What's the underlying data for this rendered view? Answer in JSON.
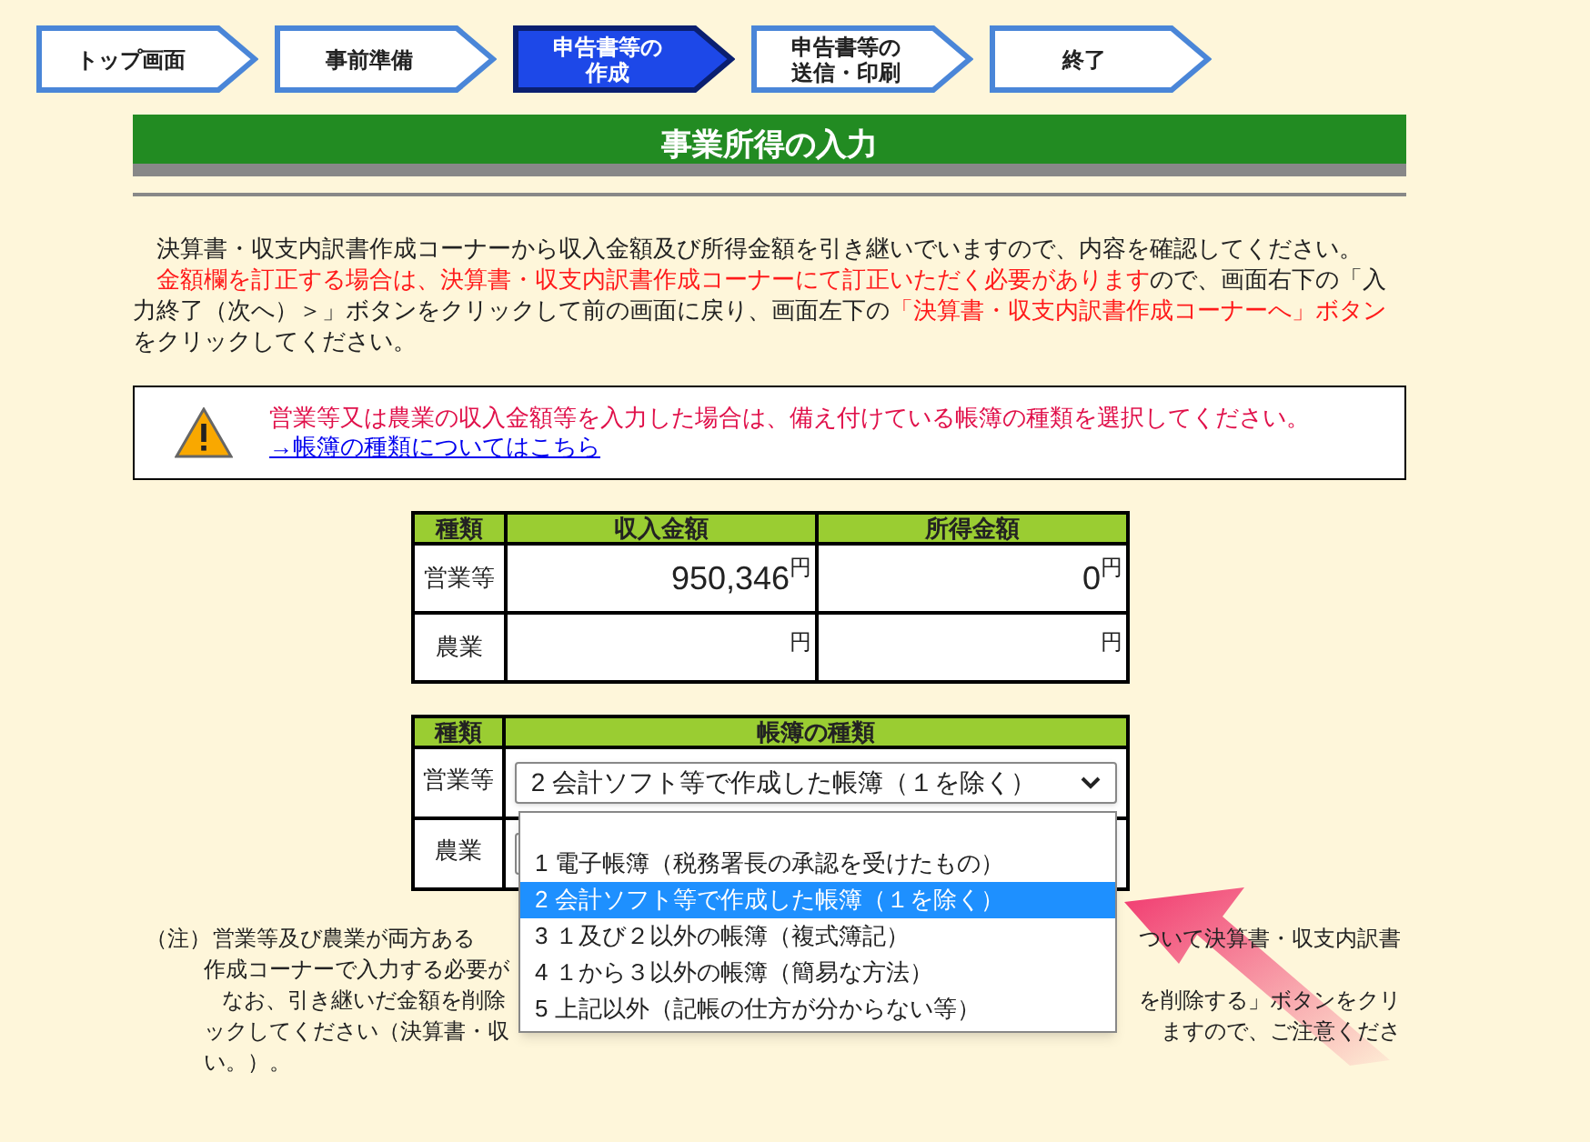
{
  "steps": [
    {
      "lines": [
        "トップ画面"
      ],
      "current": false
    },
    {
      "lines": [
        "事前準備"
      ],
      "current": false
    },
    {
      "lines": [
        "申告書等の",
        "作成"
      ],
      "current": true
    },
    {
      "lines": [
        "申告書等の",
        "送信・印刷"
      ],
      "current": false
    },
    {
      "lines": [
        "終了"
      ],
      "current": false
    }
  ],
  "title": "事業所得の入力",
  "intro": [
    {
      "segments": [
        {
          "text": "決算書・収支内訳書作成コーナーから収入金額及び所得金額を引き継いでいますので、内容を確認してください。",
          "highlight": false
        }
      ]
    },
    {
      "segments": [
        {
          "text": "金額欄を訂正する場合は、決算書・収支内訳書作成コーナーにて訂正いただく必要があります",
          "highlight": true
        },
        {
          "text": "ので、画面右下の「入力終了（次へ）＞」ボタンをクリックして前の画面に戻り、画面左下の",
          "highlight": false
        },
        {
          "text": "「決算書・収支内訳書作成コーナーへ」ボタン",
          "highlight": true
        },
        {
          "text": "をクリックしてください。",
          "highlight": false
        }
      ]
    }
  ],
  "warning": {
    "message": "営業等又は農業の収入金額等を入力した場合は、備え付けている帳簿の種類を選択してください。",
    "link": "→帳簿の種類についてはこちら"
  },
  "amounts_table": {
    "columns": [
      "種類",
      "収入金額",
      "所得金額"
    ],
    "rows": [
      {
        "type": "営業等",
        "income": "950,346",
        "income_unit": "円",
        "profit": "0",
        "profit_unit": "円"
      },
      {
        "type": "農業",
        "income_unit": "円",
        "profit_unit": "円"
      }
    ]
  },
  "books_table": {
    "columns": [
      "種類",
      "帳簿の種類"
    ],
    "rows": [
      {
        "type": "営業等",
        "value": "2  会計ソフト等で作成した帳簿（１を除く）",
        "expanded": true
      },
      {
        "type": "農業",
        "expanded": false
      }
    ]
  },
  "dropdown": {
    "options": [
      {
        "label": "1  電子帳簿（税務署長の承認を受けたもの）",
        "selected": false
      },
      {
        "label": "2  会計ソフト等で作成した帳簿（１を除く）",
        "selected": true
      },
      {
        "label": "3  １及び２以外の帳簿（複式簿記）",
        "selected": false
      },
      {
        "label": "4  １から３以外の帳簿（簡易な方法）",
        "selected": false
      },
      {
        "label": "5  上記以外（記帳の仕方が分からない等）",
        "selected": false
      }
    ]
  },
  "note": {
    "label": "（注）",
    "paragraphs": [
      {
        "lines": [
          {
            "left": "営業等及び農業が両方ある",
            "right": "ついて決算書・収支内訳書"
          },
          {
            "left": "作成コーナーで入力する必要が"
          }
        ]
      },
      {
        "lines": [
          {
            "left": "なお、引き継いだ金額を削除",
            "right": "を削除する」ボタンをクリ"
          },
          {
            "left": "ックしてください（決算書・収",
            "right": "ますので、ご注意くださ"
          },
          {
            "left": "い。）。"
          }
        ]
      }
    ]
  }
}
